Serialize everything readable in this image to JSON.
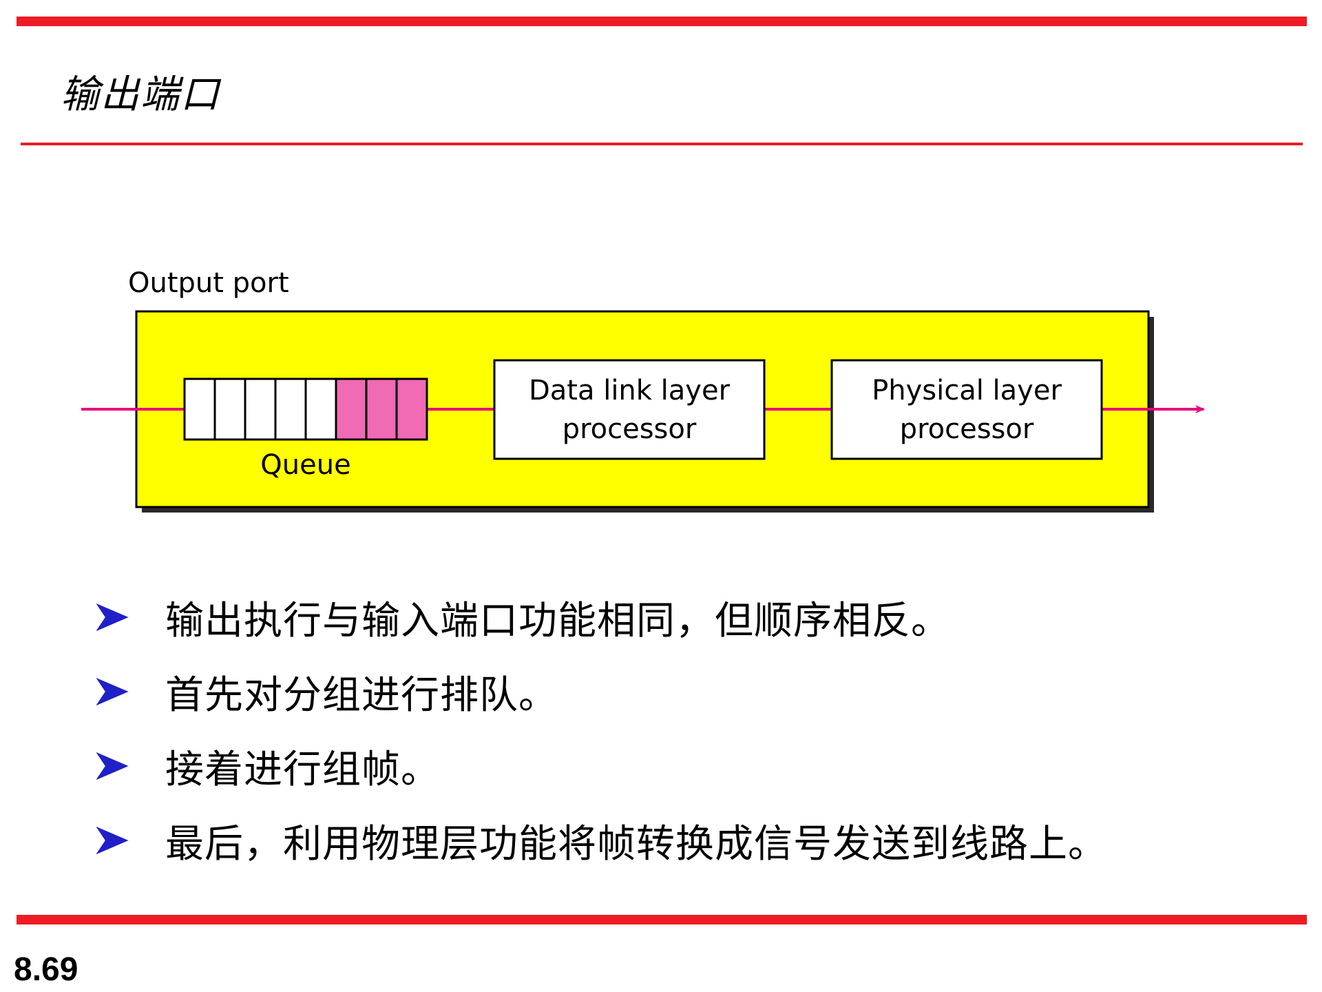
{
  "slide": {
    "title": "输出端口",
    "page_number": "8.69"
  },
  "diagram": {
    "port_label": "Output port",
    "queue_label": "Queue",
    "queue": {
      "total_slots": 8,
      "filled_slots": 3
    },
    "data_link_box": {
      "line1": "Data link layer",
      "line2": "processor"
    },
    "physical_box": {
      "line1": "Physical layer",
      "line2": "processor"
    },
    "colors": {
      "port_fill": "#ffff00",
      "packet_fill": "#f06ab4",
      "flow_line": "#e6007e",
      "rule_red": "#ee1c24",
      "bullet_blue": "#2020c8"
    }
  },
  "bullets": [
    "输出执行与输入端口功能相同，但顺序相反。",
    "首先对分组进行排队。",
    "接着进行组帧。",
    "最后，利用物理层功能将帧转换成信号发送到线路上。"
  ]
}
